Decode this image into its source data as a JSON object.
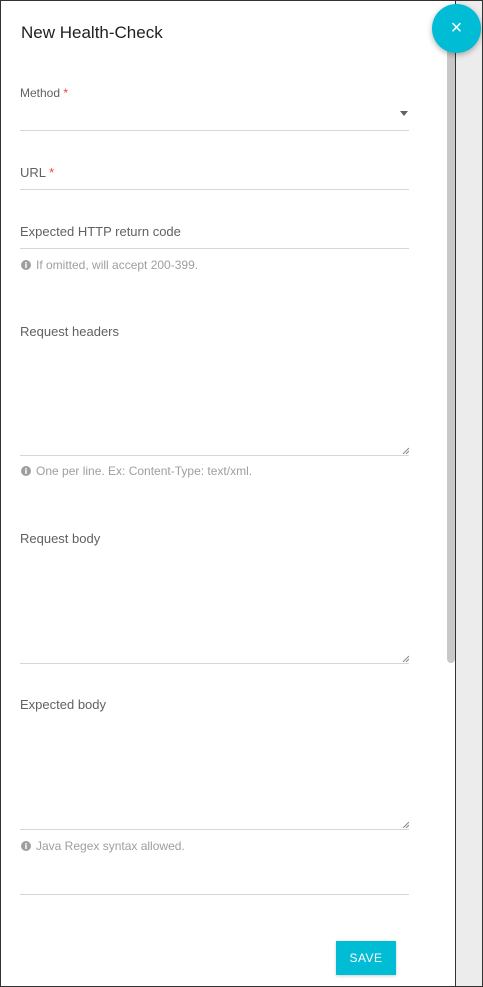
{
  "dialog": {
    "title": "New Health-Check",
    "close_icon": "×",
    "save_label": "SAVE"
  },
  "form": {
    "method_label": "Method",
    "url_label": "URL",
    "required_mark": "*",
    "expected_code_label": "Expected HTTP return code",
    "expected_code_hint": "If omitted, will accept 200-399.",
    "headers_label": "Request headers",
    "headers_hint": "One per line. Ex: Content-Type: text/xml.",
    "body_label": "Request body",
    "expected_body_label": "Expected body",
    "expected_body_hint": "Java Regex syntax allowed.",
    "info_icon": "i"
  },
  "colors": {
    "accent": "#00bcd4",
    "required": "#f44336"
  }
}
